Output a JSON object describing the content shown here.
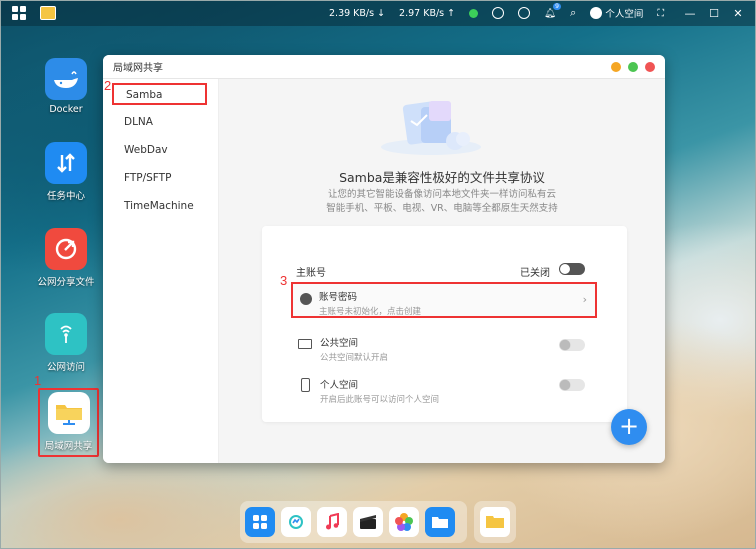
{
  "topbar": {
    "download_speed": "2.39 KB/s",
    "upload_speed": "2.97 KB/s",
    "user_label": "个人空间",
    "notification_count": "9"
  },
  "desktop_icons": [
    {
      "label": "Docker",
      "icon": "docker-whale-icon"
    },
    {
      "label": "任务中心",
      "icon": "task-center-icon"
    },
    {
      "label": "公网分享文件",
      "icon": "share-icon"
    },
    {
      "label": "公网访问",
      "icon": "remote-access-icon"
    },
    {
      "label": "局域网共享",
      "icon": "lan-share-folder-icon"
    }
  ],
  "annotations": {
    "n1": "1",
    "n2": "2",
    "n3": "3"
  },
  "window": {
    "title": "局域网共享",
    "sidebar": [
      "Samba",
      "DLNA",
      "WebDav",
      "FTP/SFTP",
      "TimeMachine"
    ],
    "heading": "Samba是兼容性极好的文件共享协议",
    "sub_line1": "让您的其它智能设备像访问本地文件夹一样访问私有云",
    "sub_line2": "智能手机、平板、电视、VR、电脑等全都原生天然支持",
    "main_account_label": "主账号",
    "main_account_status": "已关闭",
    "account_password_title": "账号密码",
    "account_password_desc": "主账号未初始化，点击创建",
    "public_space_title": "公共空间",
    "public_space_desc": "公共空间默认开启",
    "personal_space_title": "个人空间",
    "personal_space_desc": "开启后此账号可以访问个人空间",
    "plus_label": "+"
  },
  "colors": {
    "accent": "#2f8df0",
    "annotation": "#e33333",
    "folder": "#f5c542"
  }
}
